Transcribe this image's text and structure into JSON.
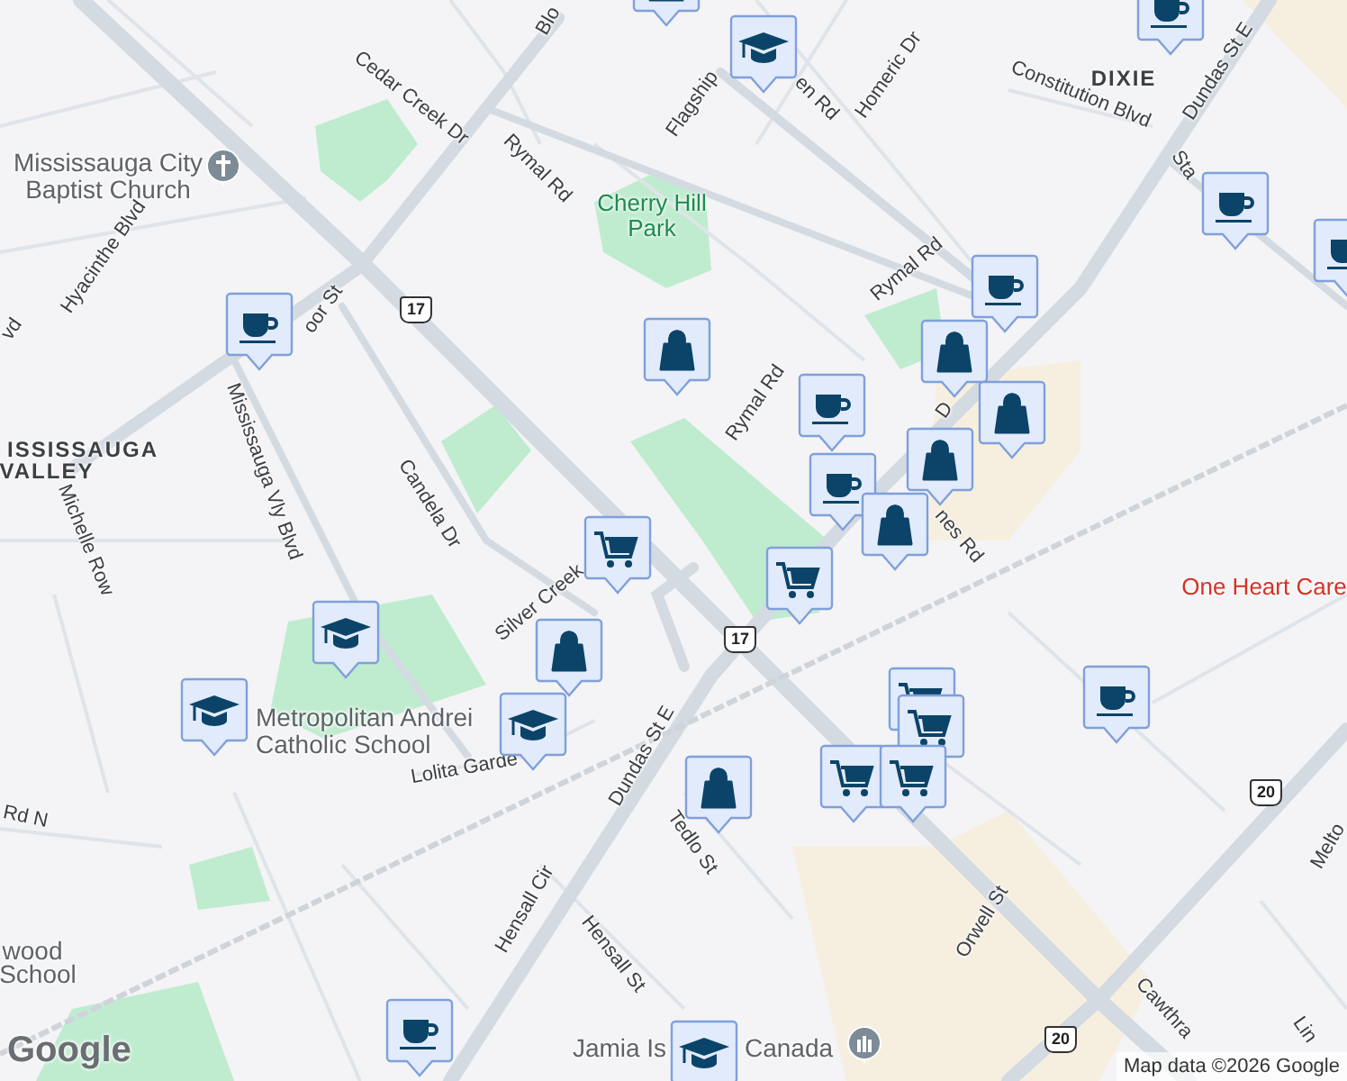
{
  "map": {
    "labels": [
      {
        "text": "Blo",
        "kind": "street"
      },
      {
        "text": "Cedar Creek Dr",
        "kind": "street"
      },
      {
        "text": "Flagship",
        "kind": "street"
      },
      {
        "text": "en Rd",
        "kind": "street"
      },
      {
        "text": "Homeric Dr",
        "kind": "street"
      },
      {
        "text": "DIXIE",
        "kind": "area"
      },
      {
        "text": "Constitution Blvd",
        "kind": "street"
      },
      {
        "text": "Dundas St E",
        "kind": "street"
      },
      {
        "text": "Sta",
        "kind": "street"
      },
      {
        "text": "Cherry Hill Park",
        "kind": "park"
      },
      {
        "text": "Mississauga City Baptist Church",
        "kind": "place"
      },
      {
        "text": "Hyacinthe Blvd",
        "kind": "street"
      },
      {
        "text": "vd",
        "kind": "street"
      },
      {
        "text": "oor St",
        "kind": "street"
      },
      {
        "text": "17",
        "kind": "shield"
      },
      {
        "text": "ISSISSAUGA",
        "kind": "area"
      },
      {
        "text": "VALLEY",
        "kind": "area"
      },
      {
        "text": "Mississauga Vly Blvd",
        "kind": "street"
      },
      {
        "text": "Michelle Row",
        "kind": "street"
      },
      {
        "text": "Candela Dr",
        "kind": "street"
      },
      {
        "text": "Rymal Rd",
        "kind": "street"
      },
      {
        "text": "Rymal Rd",
        "kind": "street"
      },
      {
        "text": "Rymal Rd",
        "kind": "street"
      },
      {
        "text": "D",
        "kind": "street"
      },
      {
        "text": "nes Rd",
        "kind": "street"
      },
      {
        "text": "Silver Creek",
        "kind": "street"
      },
      {
        "text": "Metropolitan Andrei Catholic School",
        "kind": "place"
      },
      {
        "text": "Lolita Garde",
        "kind": "street"
      },
      {
        "text": "Rd N",
        "kind": "street"
      },
      {
        "text": "Dundas St E",
        "kind": "street"
      },
      {
        "text": "Tedlo St",
        "kind": "street"
      },
      {
        "text": "Hensall Cir",
        "kind": "street"
      },
      {
        "text": "Hensall St",
        "kind": "street"
      },
      {
        "text": "wood",
        "kind": "place"
      },
      {
        "text": "School",
        "kind": "place"
      },
      {
        "text": "Jamia Is",
        "kind": "place"
      },
      {
        "text": "Canada",
        "kind": "place"
      },
      {
        "text": "One Heart Care",
        "kind": "business"
      },
      {
        "text": "Orwell St",
        "kind": "street"
      },
      {
        "text": "20",
        "kind": "shield"
      },
      {
        "text": "20",
        "kind": "shield"
      },
      {
        "text": "Cawthra",
        "kind": "street"
      },
      {
        "text": "Lin",
        "kind": "street"
      },
      {
        "text": "Melto",
        "kind": "street"
      },
      {
        "text": "17",
        "kind": "shield"
      }
    ],
    "markers": [
      {
        "kind": "cafe"
      },
      {
        "kind": "cafe"
      },
      {
        "kind": "cafe"
      },
      {
        "kind": "cafe"
      },
      {
        "kind": "cafe"
      },
      {
        "kind": "cafe"
      },
      {
        "kind": "cafe"
      },
      {
        "kind": "cafe"
      },
      {
        "kind": "cafe"
      },
      {
        "kind": "shop"
      },
      {
        "kind": "shop"
      },
      {
        "kind": "shop"
      },
      {
        "kind": "shop"
      },
      {
        "kind": "shop"
      },
      {
        "kind": "shop"
      },
      {
        "kind": "shop"
      },
      {
        "kind": "shop"
      },
      {
        "kind": "grocery"
      },
      {
        "kind": "grocery"
      },
      {
        "kind": "grocery"
      },
      {
        "kind": "grocery"
      },
      {
        "kind": "grocery"
      },
      {
        "kind": "grocery"
      },
      {
        "kind": "school"
      },
      {
        "kind": "school"
      },
      {
        "kind": "school"
      },
      {
        "kind": "school"
      },
      {
        "kind": "school"
      }
    ],
    "logo": "Google",
    "attribution": "Map data ©2026 Google"
  }
}
